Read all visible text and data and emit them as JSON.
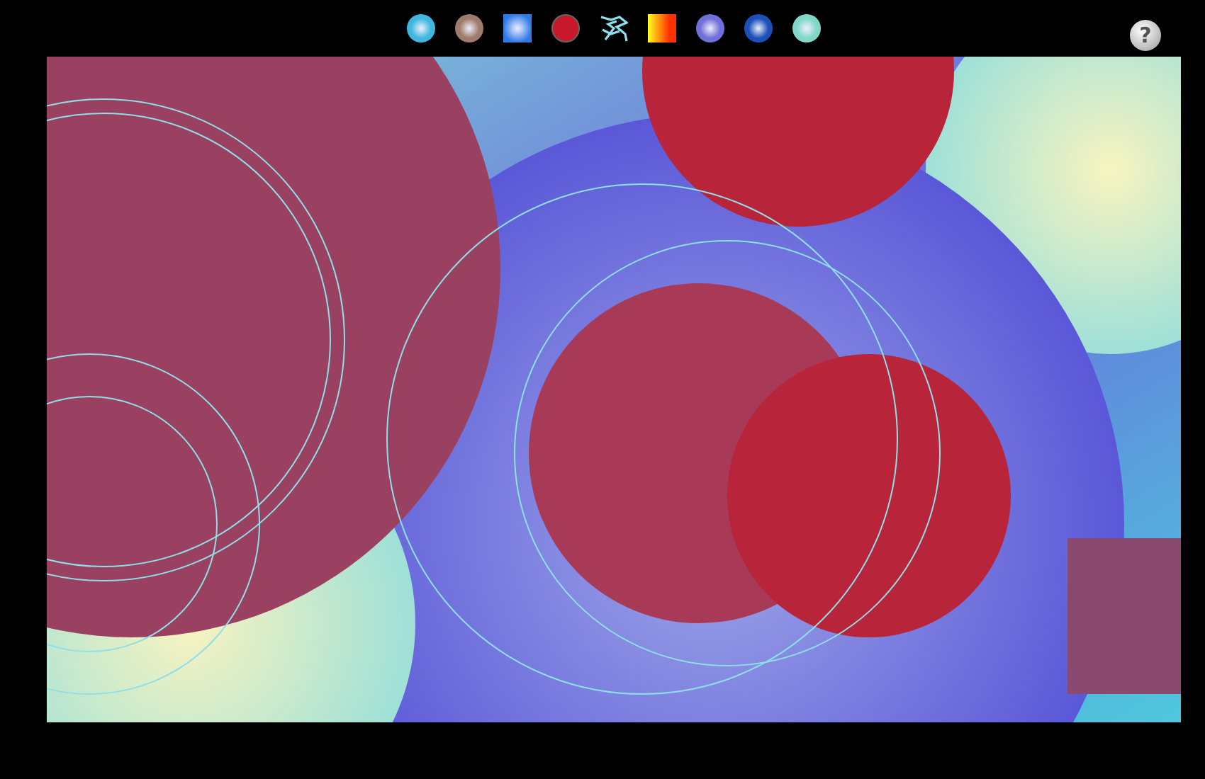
{
  "toolbar": {
    "tools": [
      {
        "kind": "sphere",
        "color": "#3fb8e0"
      },
      {
        "kind": "sphere",
        "color": "#a07a6a"
      },
      {
        "kind": "square",
        "color": "#2f7ae8"
      },
      {
        "kind": "disc",
        "color": "#c8182c"
      },
      {
        "kind": "scribble",
        "color": "#8ee0f0"
      },
      {
        "kind": "gradient",
        "color": "#ff3300"
      },
      {
        "kind": "sphere",
        "color": "#7070d8"
      },
      {
        "kind": "sphere",
        "color": "#1c50b8"
      },
      {
        "kind": "sphere",
        "color": "#80d8c8"
      }
    ]
  },
  "help": {
    "label": "?"
  }
}
